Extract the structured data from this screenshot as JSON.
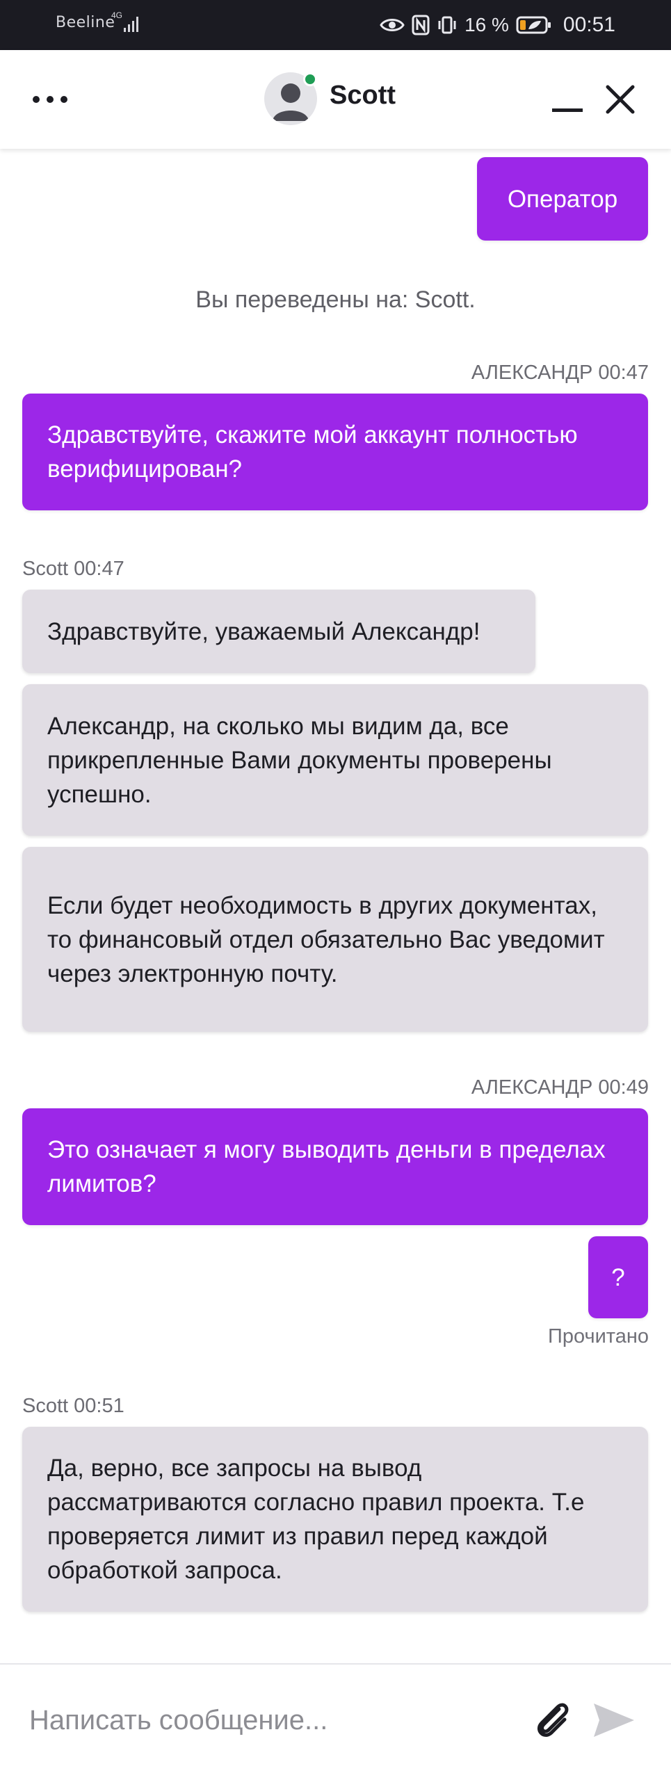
{
  "status_bar": {
    "carrier": "Beeline",
    "network": "4G",
    "battery": "16 %",
    "time": "00:51"
  },
  "header": {
    "agent_name": "Scott",
    "online_color": "#1f9d55"
  },
  "messages": {
    "msg0": {
      "text": "Оператор"
    },
    "system_note": "Вы переведены на: Scott.",
    "meta1": "АЛЕКСАНДР 00:47",
    "msg1": {
      "text": "Здравствуйте, скажите мой аккаунт полностью верифицирован?"
    },
    "meta2": "Scott 00:47",
    "msg2": {
      "text": "Здравствуйте, уважаемый Александр!"
    },
    "msg3": {
      "text": "Александр, на сколько мы видим да, все прикрепленные Вами документы проверены успешно."
    },
    "msg4": {
      "text": "Если будет необходимость в других документах, то финансовый отдел обязательно Вас уведомит через электронную почту."
    },
    "meta3": "АЛЕКСАНДР 00:49",
    "msg5": {
      "text": "Это означает я могу выводить деньги в пределах лимитов?"
    },
    "msg6": {
      "text": "?"
    },
    "read_receipt": "Прочитано",
    "meta4": "Scott 00:51",
    "msg7": {
      "text": "Да, верно, все запросы на вывод рассматриваются согласно правил проекта. Т.е проверяется лимит из правил перед каждой обработкой запроса."
    }
  },
  "composer": {
    "placeholder": "Написать сообщение..."
  },
  "colors": {
    "outgoing_bubble": "#9c27e8",
    "incoming_bubble": "#e1dde4",
    "status_bar": "#1b1b22"
  },
  "icons": {
    "menu": "more-horizontal-icon",
    "minimize": "minimize-icon",
    "close": "close-icon",
    "attach": "paperclip-icon",
    "send": "send-icon"
  }
}
